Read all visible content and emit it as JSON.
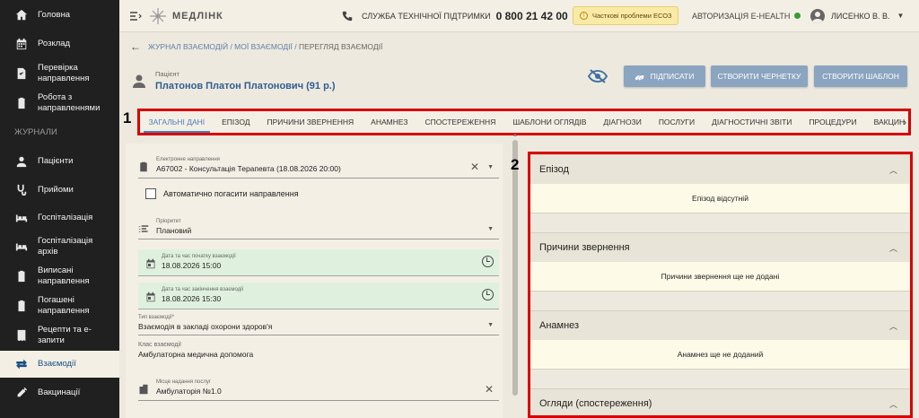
{
  "sidebar": {
    "items": [
      {
        "label": "Головна",
        "icon": "home-icon"
      },
      {
        "label": "Розклад",
        "icon": "calendar-icon"
      },
      {
        "label": "Перевірка направлення",
        "icon": "doc-check-icon"
      },
      {
        "label": "Робота з направленнями",
        "icon": "clipboard-icon"
      }
    ],
    "section": "ЖУРНАЛИ",
    "journal_items": [
      {
        "label": "Пацієнти",
        "icon": "person-icon"
      },
      {
        "label": "Прийоми",
        "icon": "stethoscope-icon"
      },
      {
        "label": "Госпіталізація",
        "icon": "bed-icon"
      },
      {
        "label": "Госпіталізація архів",
        "icon": "bed-archive-icon"
      },
      {
        "label": "Виписані направлення",
        "icon": "clipboard-icon"
      },
      {
        "label": "Погашені направлення",
        "icon": "clipboard-icon"
      },
      {
        "label": "Рецепти та е-запити",
        "icon": "receipt-icon"
      },
      {
        "label": "Взаємодії",
        "icon": "swap-icon"
      },
      {
        "label": "Вакцинації",
        "icon": "syringe-icon"
      }
    ]
  },
  "topbar": {
    "logo_text": "МЕДЛІНК",
    "support_label": "СЛУЖБА ТЕХНІЧНОЇ ПІДТРИМКИ",
    "support_phone": "0 800 21 42 00",
    "warning": "Часткові проблеми ЕСОЗ",
    "ehealth": "АВТОРИЗАЦІЯ E-HEALTH",
    "user": "ЛИСЕНКО В. В."
  },
  "breadcrumb": {
    "parts": [
      "ЖУРНАЛ ВЗАЄМОДІЙ",
      "МОЇ ВЗАЄМОДІЇ",
      "ПЕРЕГЛЯД ВЗАЄМОДІЇ"
    ],
    "sep": " / "
  },
  "patient": {
    "label": "Пацієнт",
    "name": "Платонов Платон Платонович (91 р.)"
  },
  "actions": {
    "sign": "ПІДПИСАТИ",
    "draft": "СТВОРИТИ ЧЕРНЕТКУ",
    "template": "СТВОРИТИ ШАБЛОН"
  },
  "markers": {
    "one": "1",
    "two": "2"
  },
  "tabs": [
    "ЗАГАЛЬНІ ДАНІ",
    "ЕПІЗОД",
    "ПРИЧИНИ ЗВЕРНЕННЯ",
    "АНАМНЕЗ",
    "СПОСТЕРЕЖЕННЯ",
    "ШАБЛОНИ ОГЛЯДІВ",
    "ДІАГНОЗИ",
    "ПОСЛУГИ",
    "ДІАГНОСТИЧНІ ЗВІТИ",
    "ПРОЦЕДУРИ",
    "ВАКЦИН"
  ],
  "form": {
    "referral": {
      "label": "Електронне направлення",
      "value": "А67002 - Консультація Терапевта (18.08.2026 20:00)"
    },
    "auto_close": "Автоматично погасити направлення",
    "priority": {
      "label": "Пріоритет",
      "value": "Плановий"
    },
    "start": {
      "label": "Дата та час початку взаємодії",
      "value": "18.08.2026 15:00"
    },
    "end": {
      "label": "Дата та час закінчення взаємодії",
      "value": "18.08.2026 15:30"
    },
    "type": {
      "label": "Тип взаємодії*",
      "value": "Взаємодія в закладі охорони здоров'я"
    },
    "class": {
      "label": "Клас взаємодії",
      "value": "Амбулаторна медична допомога"
    },
    "place": {
      "label": "Місце надання послуг",
      "value": "Амбулаторія №1.0"
    }
  },
  "sections": [
    {
      "title": "Епізод",
      "body": "Епізод відсутній"
    },
    {
      "title": "Причини звернення",
      "body": "Причини звернення ще не додані"
    },
    {
      "title": "Анамнез",
      "body": "Анамнез ще не доданий"
    },
    {
      "title": "Огляди (спостереження)",
      "body": ""
    }
  ]
}
